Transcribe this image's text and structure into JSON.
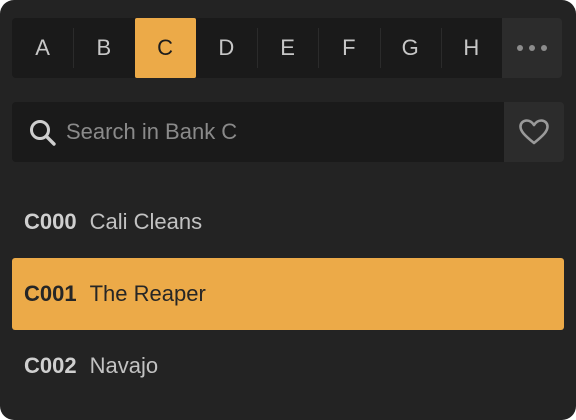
{
  "bank_tabs": [
    {
      "label": "A",
      "active": false
    },
    {
      "label": "B",
      "active": false
    },
    {
      "label": "C",
      "active": true
    },
    {
      "label": "D",
      "active": false
    },
    {
      "label": "E",
      "active": false
    },
    {
      "label": "F",
      "active": false
    },
    {
      "label": "G",
      "active": false
    },
    {
      "label": "H",
      "active": false
    }
  ],
  "more_icon": "ellipsis-icon",
  "search": {
    "placeholder": "Search in Bank C",
    "value": "",
    "icon": "search-icon"
  },
  "favorite_icon": "heart-icon",
  "presets": [
    {
      "code": "C000",
      "name": "Cali Cleans",
      "selected": false
    },
    {
      "code": "C001",
      "name": "The Reaper",
      "selected": true
    },
    {
      "code": "C002",
      "name": "Navajo",
      "selected": false
    }
  ],
  "colors": {
    "panel_bg": "#232323",
    "accent": "#ecaa48",
    "control_bg": "#1a1a1a",
    "button_bg": "#2c2c2c"
  }
}
